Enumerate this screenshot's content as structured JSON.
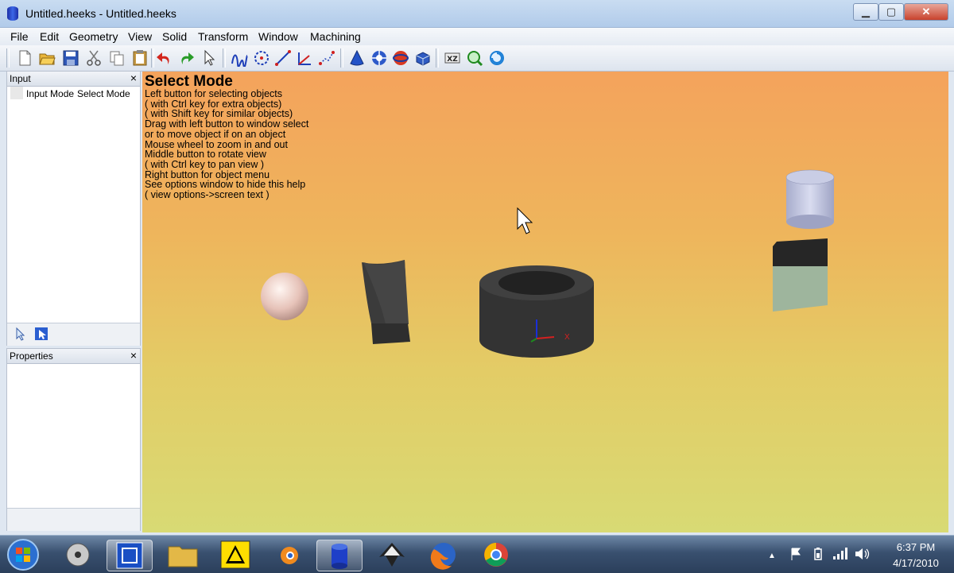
{
  "window": {
    "title": "Untitled.heeks - Untitled.heeks"
  },
  "menu": [
    "File",
    "Edit",
    "Geometry",
    "View",
    "Solid",
    "Transform",
    "Window",
    "Machining"
  ],
  "toolbar": {
    "icons": [
      "new-file-icon",
      "open-folder-icon",
      "save-icon",
      "cut-icon",
      "copy-icon",
      "paste-icon",
      "undo-icon",
      "redo-icon",
      "select-arrow-icon",
      "sketch-icon",
      "circles-icon",
      "lines-icon",
      "coordinate-system-icon",
      "points-icon",
      "cone-icon",
      "revolve-icon",
      "sphere-icon",
      "extrude-icon",
      "xyz-view-icon",
      "magnify-icon",
      "redraw-icon"
    ]
  },
  "input_panel": {
    "title": "Input",
    "close": "×",
    "col_input_mode": "Input Mode",
    "col_select_mode": "Select Mode"
  },
  "properties_panel": {
    "title": "Properties",
    "close": "×"
  },
  "viewport": {
    "help_title": "Select Mode",
    "help_lines": [
      "Left button for selecting objects",
      "( with Ctrl key for extra objects)",
      "( with Shift key for similar objects)",
      "Drag with left button to window select",
      "or to move object if on an object",
      "Mouse wheel to zoom in and out",
      "Middle button to rotate view",
      "( with Ctrl key to pan view )",
      "Right button for object menu",
      "See options window to hide this help",
      "( view options->screen text )"
    ],
    "axis_x_label": "X",
    "colors": {
      "top": "#f4a35c",
      "bottom": "#d8da74"
    }
  },
  "taskbar": {
    "apps": [
      "windows-start-icon",
      "media-center-icon",
      "qcad-icon",
      "folder-icon",
      "inkscape-warning-icon",
      "blender-icon",
      "heekscad-icon",
      "inkscape-icon",
      "firefox-icon",
      "chrome-icon"
    ],
    "time": "6:37 PM",
    "date": "4/17/2010"
  }
}
